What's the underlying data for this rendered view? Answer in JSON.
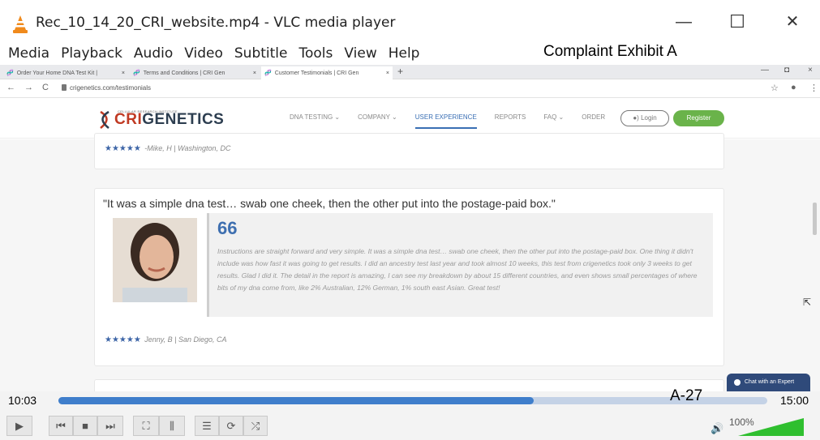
{
  "window": {
    "title": "Rec_10_14_20_CRI_website.mp4 - VLC media player",
    "minimize": "—",
    "maximize": "☐",
    "close": "✕"
  },
  "menu": [
    "Media",
    "Playback",
    "Audio",
    "Video",
    "Subtitle",
    "Tools",
    "View",
    "Help"
  ],
  "overlay": {
    "exhibit": "Complaint Exhibit A",
    "page_id": "A-27"
  },
  "browser": {
    "tabs": [
      {
        "label": "Order Your Home DNA Test Kit |"
      },
      {
        "label": "Terms and Conditions | CRI Gen"
      },
      {
        "label": "Customer Testimonials | CRI Gen"
      }
    ],
    "tab_close": "×",
    "new_tab": "+",
    "url": "crigenetics.com/testimonials",
    "win_min": "—",
    "win_restore": "◘",
    "win_close": "×"
  },
  "site": {
    "logo_cri": "CRI",
    "logo_genetics": "GENETICS",
    "logo_sub": "CELLULAR RESEARCH INSTITUTE",
    "nav": [
      "DNA TESTING ⌄",
      "COMPANY ⌄",
      "USER EXPERIENCE",
      "REPORTS",
      "FAQ ⌄",
      "ORDER"
    ],
    "login": "●) Login",
    "register": "Register"
  },
  "testimonials": [
    {
      "stars": "★★★★★",
      "author": "-Mike, H | Washington, DC"
    },
    {
      "title": "\"It was a simple dna test… swab one cheek, then the other put into the postage-paid box.\"",
      "quote_mark": "66",
      "body": "Instructions are straight forward and very simple. It was a simple dna test… swab one cheek, then the other put into the postage-paid box. One thing it didn't include was how fast it was going to get results. I did an ancestry test last year and took almost 10 weeks, this test from crigenetics took only 3 weeks to get results. Glad I did it. The detail in the report is amazing, I can see my breakdown by about 15 different countries, and even shows small percentages of where bits of my dna come from, like 2% Australian, 12% German, 1% south east Asian. Great test!",
      "stars": "★★★★★",
      "author": "Jenny, B | San Diego, CA"
    }
  ],
  "chat": "Chat with an Expert",
  "player": {
    "elapsed": "10:03",
    "total": "15:00",
    "progress_fraction": 0.67,
    "volume": "100%",
    "volume_level": 1.0,
    "colors": {
      "seek_fill": "#3f7ecb",
      "volume_green": "#2fbf2f"
    }
  }
}
